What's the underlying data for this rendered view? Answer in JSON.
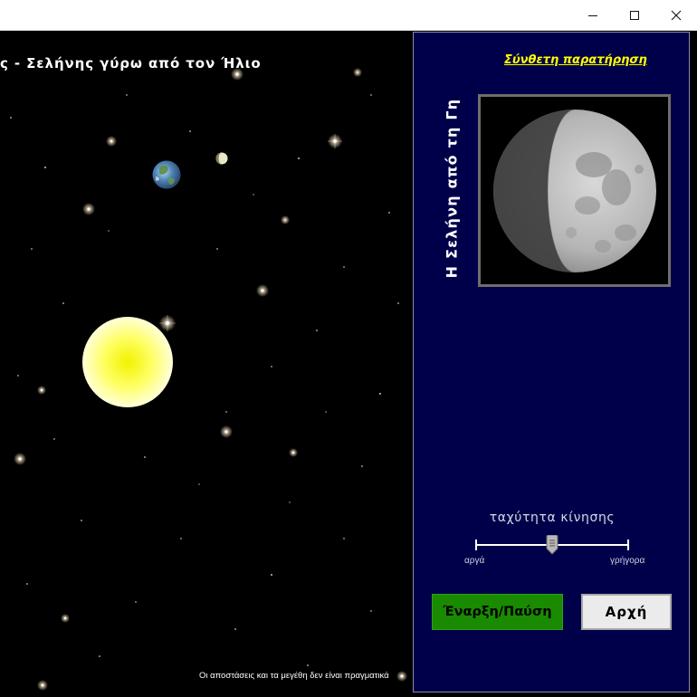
{
  "window": {
    "minimize_icon": "minimize-icon",
    "maximize_icon": "maximize-icon",
    "close_icon": "close-icon"
  },
  "scene": {
    "title": "ς - Σελήνης γύρω από τον Ήλιο",
    "disclaimer": "Οι αποστάσεις και τα μεγέθη δεν είναι πραγματικά",
    "colors": {
      "background": "#000000",
      "sun": "#ffff33",
      "moon": "#e8e8c8"
    }
  },
  "panel": {
    "observe_link": "Σύνθετη παρατήρηση",
    "moon_view_label": "Η Σελήνη από τη Γη",
    "speed_label": "ταχύτητα κίνησης",
    "slow_label": "αργά",
    "fast_label": "γρήγορα",
    "speed_value": 0.5,
    "start_pause_label": "Έναρξη/Παύση",
    "reset_label": "Αρχή",
    "colors": {
      "background": "#00004a",
      "link": "#ffff00",
      "start_button": "#1a8a00",
      "reset_button": "#ebebeb"
    }
  }
}
